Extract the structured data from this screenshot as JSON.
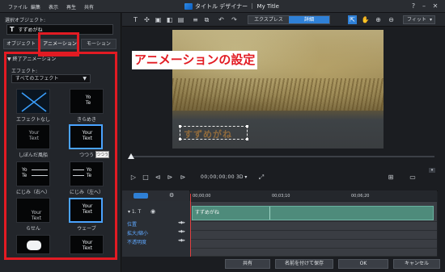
{
  "menubar": {
    "items": [
      "ファイル",
      "編集",
      "表示",
      "再生",
      "共有"
    ],
    "title": "タイトル デザイナー ｜ My Title"
  },
  "left_panel": {
    "selected_object_label": "選択オブジェクト:",
    "selected_object_value": "すずめがね",
    "tabs": [
      "オブジェクト",
      "アニメーション",
      "モーション"
    ],
    "active_tab": "アニメーション",
    "section_title": "▼ 終了アニメーション",
    "effect_label": "エフェクト:",
    "effect_select": "すべてのエフェクト",
    "effects": [
      {
        "label": "エフェクトなし",
        "thumb": "X"
      },
      {
        "label": "きらめき",
        "thumb": "Yo\nTe"
      },
      {
        "label": "しぼんだ風船",
        "thumb": "Your\nText"
      },
      {
        "label": "つつう",
        "thumb": "Your\nText"
      },
      {
        "label": "にじみ（右へ）",
        "thumb": "Yo\nTe"
      },
      {
        "label": "にじみ（左へ）",
        "thumb": "Yo\nTe"
      },
      {
        "label": "らせん",
        "thumb": "Your\nText"
      },
      {
        "label": "ウェーブ",
        "thumb": "Your\nText"
      },
      {
        "label": "",
        "thumb": ""
      },
      {
        "label": "",
        "thumb": "Your\nText"
      }
    ],
    "tooltip": "つつう"
  },
  "toolbar": {
    "mode_express": "エクスプレス",
    "mode_detail": "詳細",
    "fit_label": "フィット"
  },
  "preview": {
    "overlay_title": "アニメーションの設定",
    "text_object": "すずめがね"
  },
  "transport": {
    "timecode": "00;00;00;00",
    "mode3d": "3D ▾"
  },
  "timeline": {
    "timecodes": [
      "00;00;00",
      "00;03;10",
      "00;06;20"
    ],
    "track_label": "▾ 1. T",
    "clip_label": "すずめがね",
    "rows": [
      "位置",
      "拡大/縮小",
      "不透明度"
    ]
  },
  "bottom": {
    "share": "共有",
    "save_as": "名前を付けて保存",
    "ok": "OK",
    "cancel": "キャンセル"
  },
  "colors": {
    "highlight_red": "#e21b23",
    "accent_blue": "#2f80d6",
    "clip_green": "#4e8b7b"
  }
}
